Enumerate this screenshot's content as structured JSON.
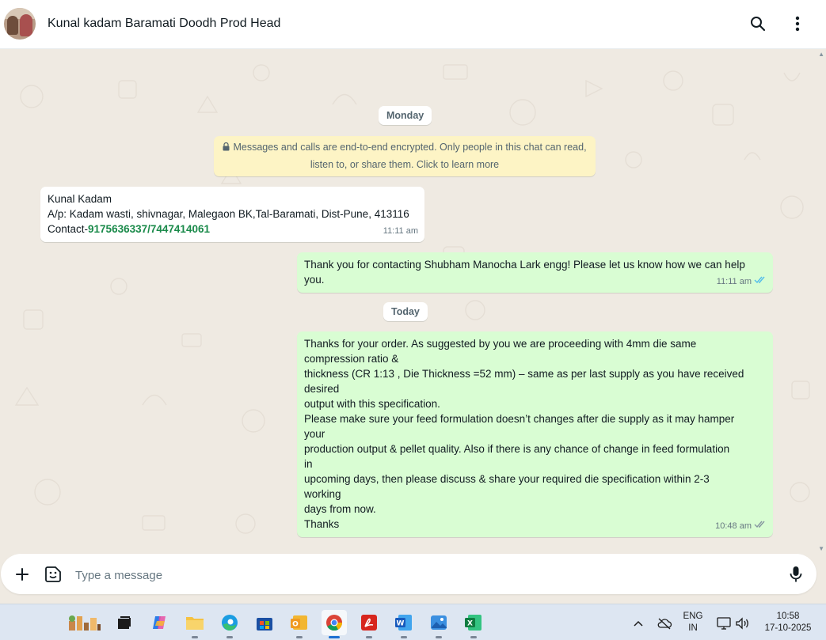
{
  "header": {
    "title": "Kunal kadam Baramati Doodh Prod Head",
    "search_icon": "search-icon",
    "menu_icon": "kebab-menu-icon"
  },
  "chat": {
    "date_monday": "Monday",
    "encryption_notice_line1": "Messages and calls are end-to-end encrypted. Only people in this chat can read,",
    "encryption_notice_line2": "listen to, or share them. Click to learn more",
    "messages": [
      {
        "direction": "incoming",
        "lines": [
          "Kunal Kadam",
          "A/p: Kadam wasti, shivnagar, Malegaon BK,Tal-Baramati, Dist-Pune, 413116"
        ],
        "contact_prefix": "Contact-",
        "contact_number1": "9175636337",
        "contact_sep": "/",
        "contact_number2": "7447414061",
        "time": "11:11 am"
      },
      {
        "direction": "outgoing",
        "lines": [
          "Thank you for contacting Shubham Manocha Lark engg! Please let us know how we can help",
          "you."
        ],
        "time": "11:11 am",
        "status": "read"
      },
      {
        "direction": "outgoing",
        "lines": [
          "Thanks for your order. As suggested by you we are proceeding with 4mm die same",
          "compression ratio &",
          "thickness (CR 1:13  , Die Thickness =52 mm)  – same as per last supply as you have received",
          "desired",
          "output with this specification.",
          "Please make sure your feed formulation doesn’t changes after die supply as it may hamper",
          "your",
          "production output & pellet quality. Also if there is any chance of change in feed formulation",
          "in",
          "upcoming days, then please discuss & share your required die specification within 2-3",
          "working",
          "days from now.",
          "Thanks"
        ],
        "time": "10:48 am",
        "status": "delivered"
      }
    ],
    "date_today": "Today"
  },
  "composer": {
    "placeholder": "Type a message",
    "attach_icon": "plus-icon",
    "emoji_icon": "sticker-icon",
    "mic_icon": "mic-icon"
  },
  "taskbar": {
    "apps": [
      "widgets-icon",
      "task-view-icon",
      "copilot-icon",
      "file-explorer-icon",
      "edge-icon",
      "microsoft-store-icon",
      "outlook-icon",
      "chrome-icon",
      "acrobat-icon",
      "word-icon",
      "photos-icon",
      "excel-icon"
    ],
    "lang_line1": "ENG",
    "lang_line2": "IN",
    "time": "10:58",
    "date": "17-10-2025"
  },
  "colors": {
    "accent_green": "#1a8a4a",
    "outgoing_bubble": "#d9fdd3",
    "read_tick": "#53bdeb"
  }
}
